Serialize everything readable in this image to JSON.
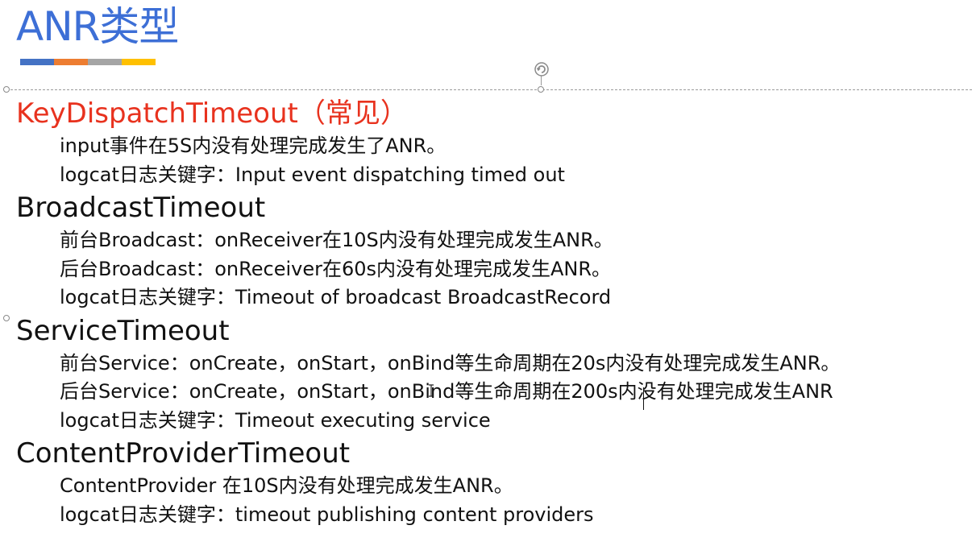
{
  "slide": {
    "title": "ANR类型",
    "title_color": "#3d6fd6",
    "accent_bar_colors": [
      "#4472c4",
      "#ed7d31",
      "#a5a5a5",
      "#ffc000"
    ]
  },
  "sections": [
    {
      "heading": "KeyDispatchTimeout（常见）",
      "heading_color": "#e8321e",
      "lines": [
        "input事件在5S内没有处理完成发生了ANR。",
        "logcat日志关键字：Input event dispatching timed out"
      ]
    },
    {
      "heading": "BroadcastTimeout",
      "heading_color": "#111111",
      "lines": [
        "前台Broadcast：onReceiver在10S内没有处理完成发生ANR。",
        "后台Broadcast：onReceiver在60s内没有处理完成发生ANR。",
        "logcat日志关键字：Timeout of broadcast BroadcastRecord"
      ]
    },
    {
      "heading": "ServiceTimeout",
      "heading_color": "#111111",
      "lines": [
        "前台Service：onCreate，onStart，onBind等生命周期在20s内没有处理完成发生ANR。",
        "后台Service：onCreate，onStart，onBind等生命周期在200s内没有处理完成发生ANR",
        "logcat日志关键字：Timeout executing service"
      ]
    },
    {
      "heading": "ContentProviderTimeout",
      "heading_color": "#111111",
      "lines": [
        "ContentProvider 在10S内没有处理完成发生ANR。",
        "logcat日志关键字：timeout publishing content providers"
      ]
    }
  ],
  "icons": {
    "rotate_handle": "rotate-icon",
    "mouse_cursor": "text-ibeam-cursor-icon"
  }
}
